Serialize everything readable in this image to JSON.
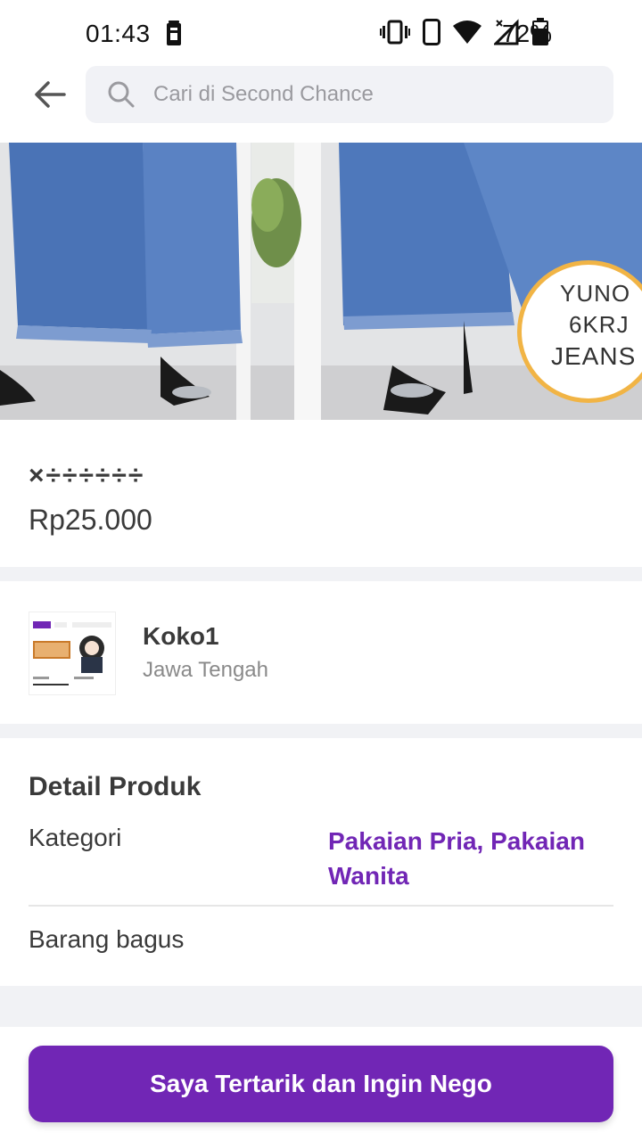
{
  "status_bar": {
    "time": "01:43",
    "battery_percent": "72%",
    "icons": [
      "battery-saver-icon",
      "vibrate-icon",
      "phone-icon",
      "wifi-icon",
      "signal-icon",
      "battery-icon"
    ]
  },
  "app_bar": {
    "back_icon": "arrow-left-icon",
    "search_placeholder": "Cari di Second Chance"
  },
  "product": {
    "image_badge": [
      "YUNO",
      "6KRJ",
      "JEANS"
    ],
    "name": "×÷÷÷÷÷÷",
    "price": "Rp25.000"
  },
  "seller": {
    "name": "Koko1",
    "location": "Jawa Tengah"
  },
  "detail": {
    "heading": "Detail Produk",
    "category_label": "Kategori",
    "category_value": "Pakaian Pria, Pakaian Wanita",
    "description": "Barang bagus"
  },
  "cta": {
    "label": "Saya Tertarik dan Ingin Nego"
  },
  "colors": {
    "primary": "#7126b5",
    "background_band": "#f1f2f5",
    "text": "#3a3a3a",
    "muted": "#8a8a8a"
  }
}
